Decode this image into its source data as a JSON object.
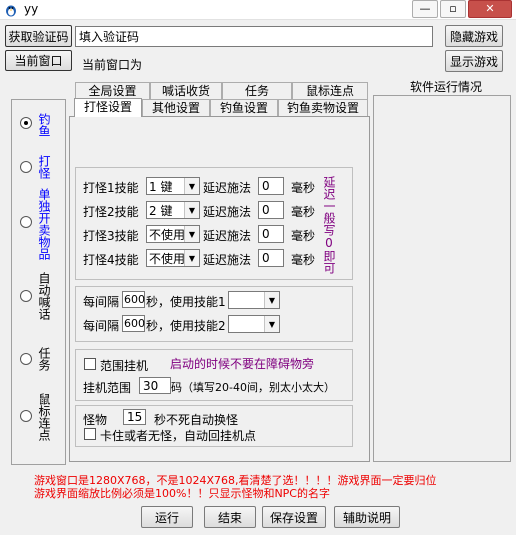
{
  "window": {
    "title": "yy",
    "min_glyph": "—",
    "max_glyph": "▫",
    "close_glyph": "✕"
  },
  "top": {
    "get_code_btn": "获取验证码",
    "code_input_placeholder": "填入验证码",
    "hide_game_btn": "隐藏游戏",
    "current_window_btn": "当前窗口",
    "current_window_label": "当前窗口为",
    "show_game_btn": "显示游戏"
  },
  "status_panel": {
    "title": "软件运行情况"
  },
  "side_radios": [
    {
      "label": "钓鱼",
      "checked": true,
      "color": "#0000ff"
    },
    {
      "label": "打怪",
      "checked": false,
      "color": "#0000ff"
    },
    {
      "label": "单独开卖物品",
      "checked": false,
      "color": "#0000ff"
    },
    {
      "label": "自动喊话",
      "checked": false,
      "color": "#000000"
    },
    {
      "label": "任务",
      "checked": false,
      "color": "#000000"
    },
    {
      "label": "鼠标连点",
      "checked": false,
      "color": "#000000"
    }
  ],
  "tabs_back": [
    "全局设置",
    "喊话收货",
    "任务",
    "鼠标连点"
  ],
  "tabs_front": [
    "打怪设置",
    "其他设置",
    "钓鱼设置",
    "钓鱼卖物设置"
  ],
  "skills": [
    {
      "label": "打怪1技能",
      "key": "1 键",
      "delay_label": "延迟施法",
      "delay": "0",
      "unit": "毫秒"
    },
    {
      "label": "打怪2技能",
      "key": "2 键",
      "delay_label": "延迟施法",
      "delay": "0",
      "unit": "毫秒"
    },
    {
      "label": "打怪3技能",
      "key": "不使用",
      "delay_label": "延迟施法",
      "delay": "0",
      "unit": "毫秒"
    },
    {
      "label": "打怪4技能",
      "key": "不使用",
      "delay_label": "延迟施法",
      "delay": "0",
      "unit": "毫秒"
    }
  ],
  "delay_hint": "延迟一般写0即可",
  "interval": [
    {
      "prefix": "每间隔",
      "value": "600",
      "suffix": "秒，使用技能1",
      "skill": ""
    },
    {
      "prefix": "每间隔",
      "value": "600",
      "suffix": "秒，使用技能2",
      "skill": ""
    }
  ],
  "range": {
    "checkbox_label": "范围挂机",
    "hint": "启动的时候不要在障碍物旁",
    "range_label": "挂机范围",
    "range_value": "30",
    "range_suffix": "码（填写20-40间，别太小太大）"
  },
  "monster": {
    "label": "怪物",
    "value": "15",
    "suffix": "秒不死自动换怪",
    "stuck_label": "卡住或者无怪，自动回挂机点"
  },
  "notes": [
    "游戏窗口是1280X768，不是1024X768,看清楚了选！！！！游戏界面一定要归位",
    "游戏界面缩放比例必须是100%！！只显示怪物和NPC的名字"
  ],
  "bottom_buttons": {
    "run": "运行",
    "stop": "结束",
    "save": "保存设置",
    "help": "辅助说明"
  }
}
